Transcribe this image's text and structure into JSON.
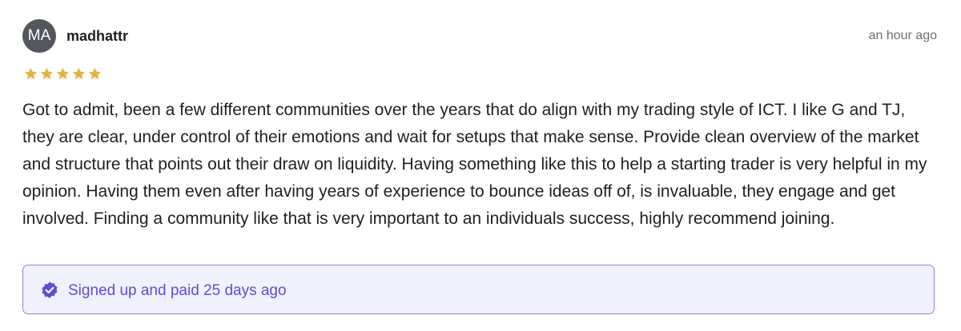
{
  "review": {
    "avatar_initials": "MA",
    "username": "madhattr",
    "timestamp": "an hour ago",
    "rating": 5,
    "rating_max": 5,
    "star_color": "#e6b24a",
    "body": "Got to admit, been a few different communities over the years that do align with my trading style of ICT. I like G and TJ, they are clear, under control of their emotions and wait for setups that make sense. Provide clean overview of the market and structure that points out their draw on liquidity. Having something like this to help a starting trader is very helpful in my opinion. Having them even after having years of experience to bounce ideas off of, is invaluable, they engage and get involved. Finding a community like that is very important to an individuals success, highly recommend joining."
  },
  "purchase": {
    "icon": "verified-badge-icon",
    "text": "Signed up and paid 25 days ago",
    "accent_color": "#5a4fd6"
  }
}
